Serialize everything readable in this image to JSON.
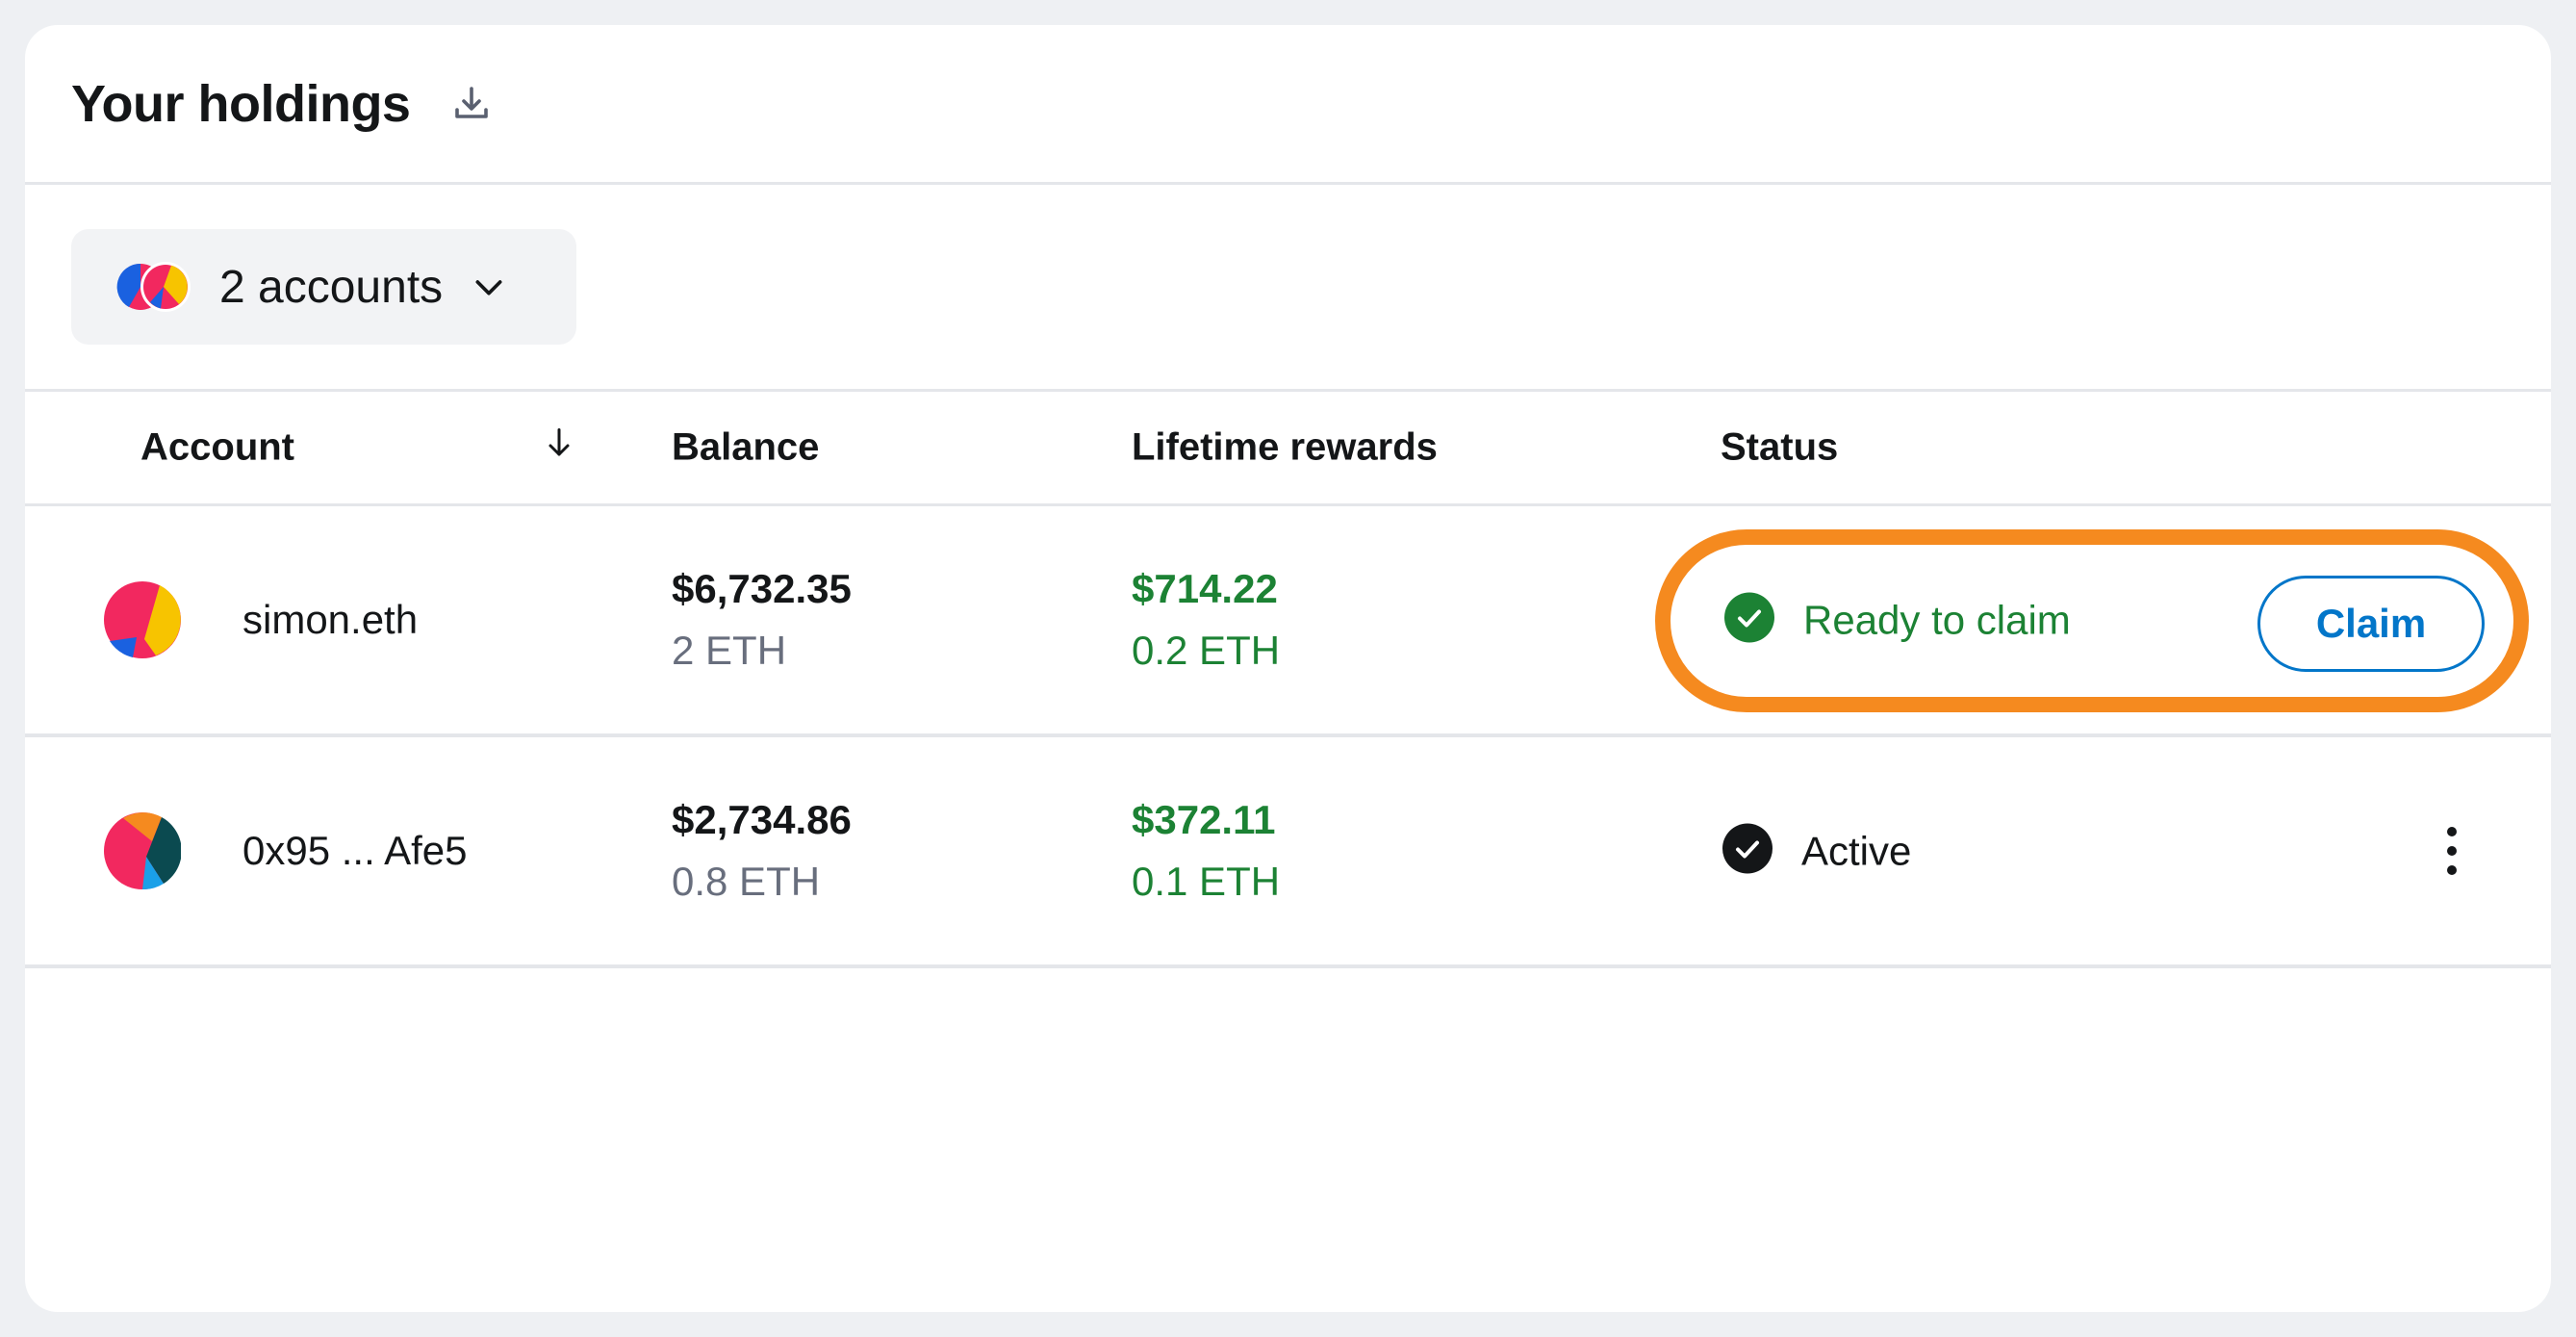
{
  "header": {
    "title": "Your holdings",
    "download_icon": "download-icon"
  },
  "account_selector": {
    "label": "2 accounts",
    "icon": "chevron-down-icon"
  },
  "table": {
    "columns": {
      "account": "Account",
      "balance": "Balance",
      "lifetime_rewards": "Lifetime rewards",
      "status": "Status"
    },
    "sort_icon": "arrow-down-icon",
    "rows": [
      {
        "account": "simon.eth",
        "balance_usd": "$6,732.35",
        "balance_eth": "2 ETH",
        "rewards_usd": "$714.22",
        "rewards_eth": "0.2 ETH",
        "status": "Ready to claim",
        "action": "Claim"
      },
      {
        "account": "0x95 ... Afe5",
        "balance_usd": "$2,734.86",
        "balance_eth": "0.8 ETH",
        "rewards_usd": "$372.11",
        "rewards_eth": "0.1 ETH",
        "status": "Active"
      }
    ]
  },
  "colors": {
    "accent_blue": "#0376c9",
    "success_green": "#1c8234",
    "highlight_orange": "#f58a1f",
    "muted_text": "#686e7d"
  }
}
